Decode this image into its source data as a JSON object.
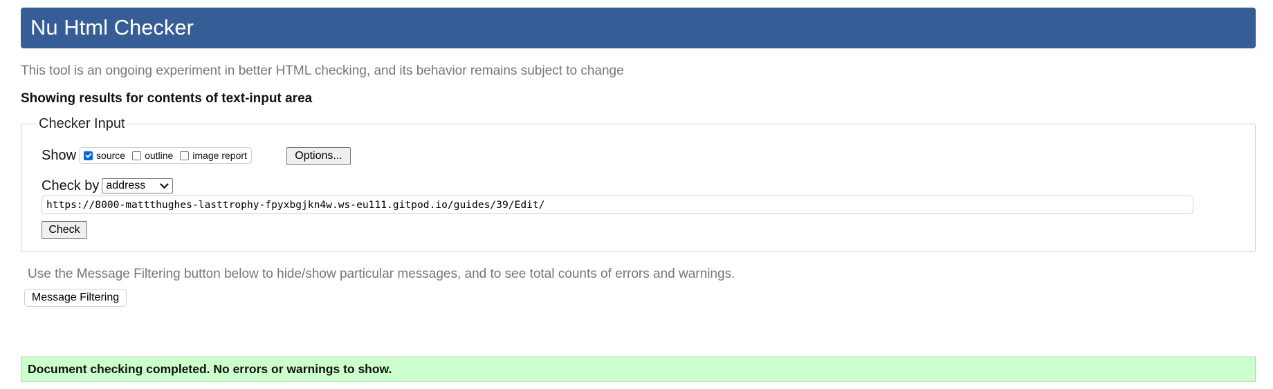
{
  "header": {
    "title": "Nu Html Checker",
    "accent_color": "#365d95"
  },
  "intro_text": "This tool is an ongoing experiment in better HTML checking, and its behavior remains subject to change",
  "results_heading": "Showing results for contents of text-input area",
  "checker_input": {
    "legend": "Checker Input",
    "show_label": "Show",
    "show_options": [
      {
        "label": "source",
        "checked": true
      },
      {
        "label": "outline",
        "checked": false
      },
      {
        "label": "image report",
        "checked": false
      }
    ],
    "options_button": "Options...",
    "check_by_label": "Check by",
    "check_by_selected": "address",
    "url_value": "https://8000-mattthughes-lasttrophy-fpyxbgjkn4w.ws-eu111.gitpod.io/guides/39/Edit/",
    "check_button": "Check"
  },
  "filtering": {
    "note": "Use the Message Filtering button below to hide/show particular messages, and to see total counts of errors and warnings.",
    "button": "Message Filtering"
  },
  "status": {
    "message": "Document checking completed. No errors or warnings to show.",
    "color": "#ccffcc"
  }
}
